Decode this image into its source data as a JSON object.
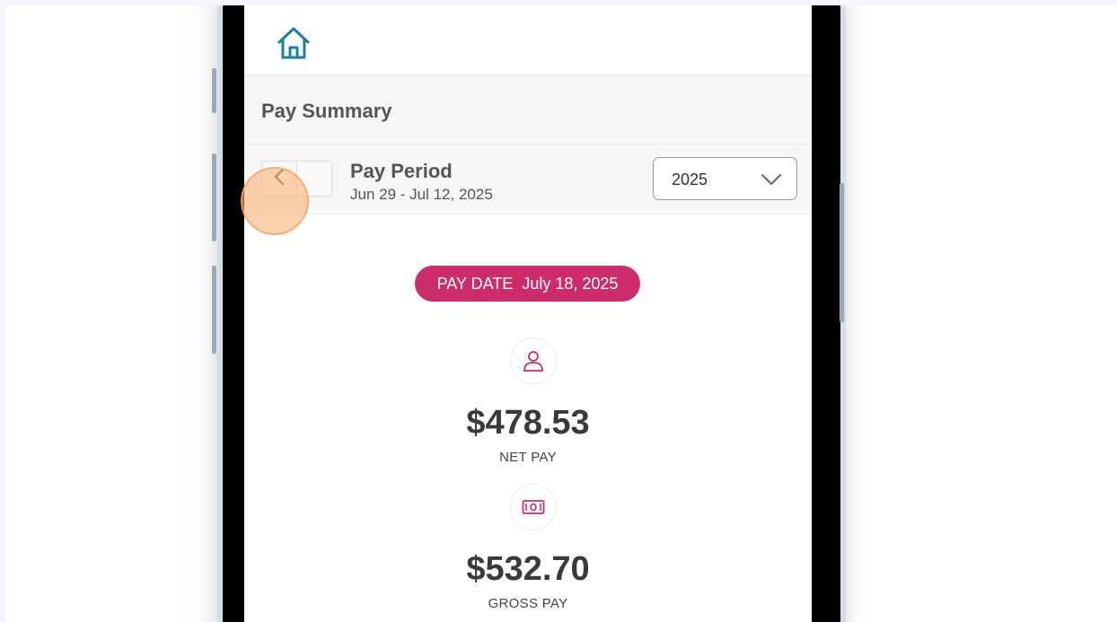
{
  "app": {
    "home_icon": "home-icon",
    "accent_color": "#cc2d6a",
    "icon_teal": "#1e7ea0"
  },
  "section": {
    "title": "Pay Summary"
  },
  "period": {
    "title": "Pay Period",
    "range": "Jun 29 - Jul 12, 2025",
    "prev_icon": "chevron-left-icon",
    "year_selected": "2025"
  },
  "pay_date": {
    "label": "PAY DATE",
    "value": "July 18, 2025"
  },
  "net_pay": {
    "icon": "person-icon",
    "amount": "$478.53",
    "label": "NET PAY"
  },
  "gross_pay": {
    "icon": "money-icon",
    "amount": "$532.70",
    "label": "GROSS PAY"
  }
}
